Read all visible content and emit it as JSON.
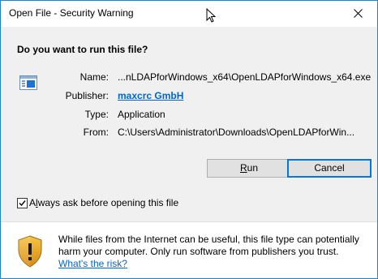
{
  "window": {
    "title": "Open File - Security Warning",
    "accent": "#1883d7"
  },
  "question": "Do you want to run this file?",
  "details": {
    "name_label": "Name:",
    "name_value": "...nLDAPforWindows_x64\\OpenLDAPforWindows_x64.exe",
    "publisher_label": "Publisher:",
    "publisher_value": "maxcrc GmbH",
    "type_label": "Type:",
    "type_value": "Application",
    "from_label": "From:",
    "from_value": "C:\\Users\\Administrator\\Downloads\\OpenLDAPforWin..."
  },
  "buttons": {
    "run_prefix": "",
    "run_mnemonic": "R",
    "run_rest": "un",
    "cancel": "Cancel"
  },
  "checkbox": {
    "checked": true,
    "label_prefix": "A",
    "label_mnemonic": "l",
    "label_rest": "ways ask before opening this file"
  },
  "footer": {
    "text": "While files from the Internet can be useful, this file type can potentially harm your computer. Only run software from publishers you trust.",
    "link": "What's the risk?"
  },
  "icons": {
    "close": "close-icon",
    "cursor": "mouse-cursor-icon",
    "file": "application-file-icon",
    "shield": "warning-shield-icon"
  }
}
